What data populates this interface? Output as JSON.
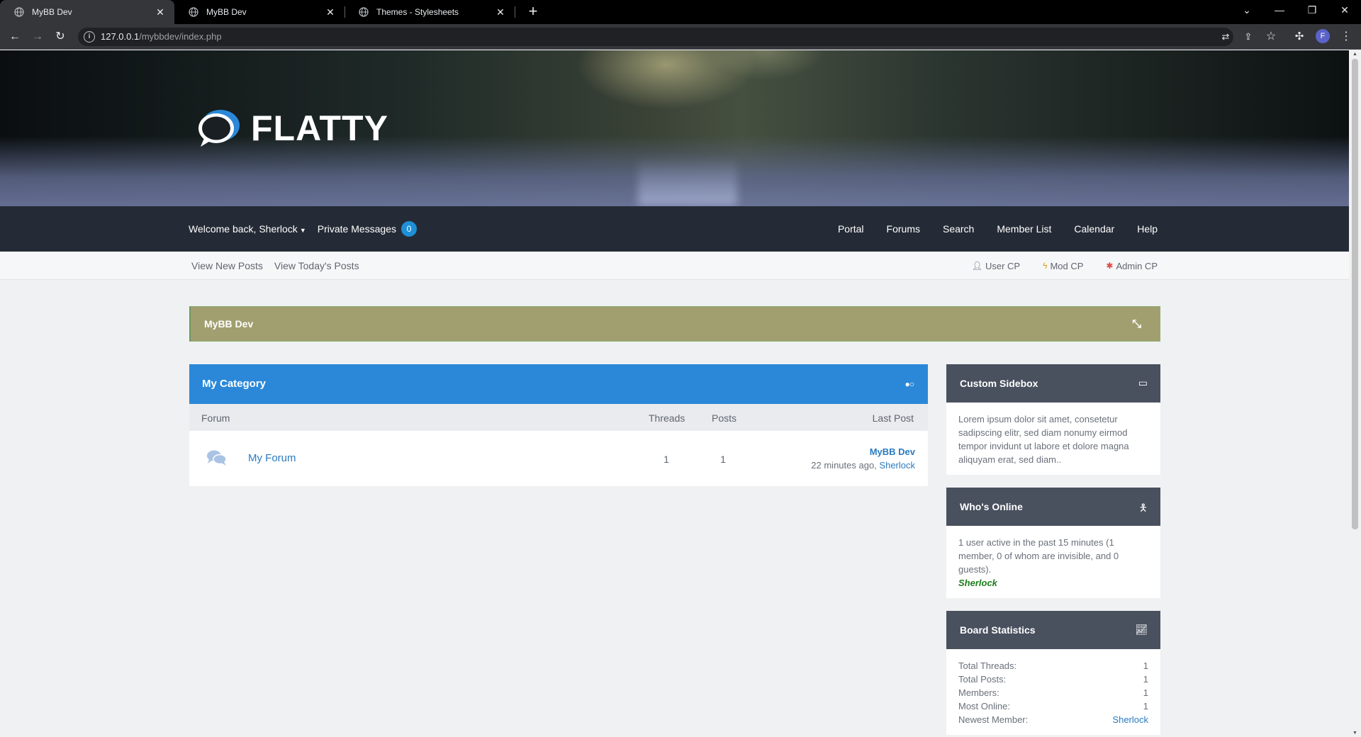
{
  "browser": {
    "tabs": [
      {
        "title": "MyBB Dev",
        "active": true
      },
      {
        "title": "MyBB Dev",
        "active": false
      },
      {
        "title": "Themes - Stylesheets",
        "active": false
      }
    ],
    "url_host": "127.0.0.1",
    "url_path": "/mybbdev/index.php",
    "profile_initial": "F"
  },
  "header": {
    "logo_text": "FLATTY"
  },
  "navbar": {
    "welcome": "Welcome back, Sherlock",
    "private_messages": "Private Messages",
    "pm_count": "0",
    "links": [
      "Portal",
      "Forums",
      "Search",
      "Member List",
      "Calendar",
      "Help"
    ]
  },
  "subbar": {
    "left": [
      "View New Posts",
      "View Today's Posts"
    ],
    "right": [
      {
        "label": "User CP",
        "icon": "user-icon",
        "color": "#5f6570"
      },
      {
        "label": "Mod CP",
        "icon": "bolt-icon",
        "color": "#e0a020"
      },
      {
        "label": "Admin CP",
        "icon": "cog-icon",
        "color": "#e04848"
      }
    ]
  },
  "announcement": {
    "title": "MyBB Dev",
    "color": "#a19f6f"
  },
  "category": {
    "title": "My Category",
    "color": "#2b88d8",
    "columns": {
      "forum": "Forum",
      "threads": "Threads",
      "posts": "Posts",
      "last_post": "Last Post"
    },
    "forums": [
      {
        "name": "My Forum",
        "threads": "1",
        "posts": "1",
        "last_post_title": "MyBB Dev",
        "last_post_time": "22 minutes ago,",
        "last_post_user": "Sherlock"
      }
    ]
  },
  "sidebar": {
    "custom": {
      "title": "Custom Sidebox",
      "text": "Lorem ipsum dolor sit amet, consetetur sadipscing elitr, sed diam nonumy eirmod tempor invidunt ut labore et dolore magna aliquyam erat, sed diam.."
    },
    "online": {
      "title": "Who's Online",
      "text": "1 user active in the past 15 minutes (1 member, 0 of whom are invisible, and 0 guests).",
      "member": "Sherlock"
    },
    "stats": {
      "title": "Board Statistics",
      "rows": [
        {
          "label": "Total Threads:",
          "value": "1"
        },
        {
          "label": "Total Posts:",
          "value": "1"
        },
        {
          "label": "Members:",
          "value": "1"
        },
        {
          "label": "Most Online:",
          "value": "1"
        },
        {
          "label": "Newest Member:",
          "value": "Sherlock"
        }
      ]
    }
  }
}
